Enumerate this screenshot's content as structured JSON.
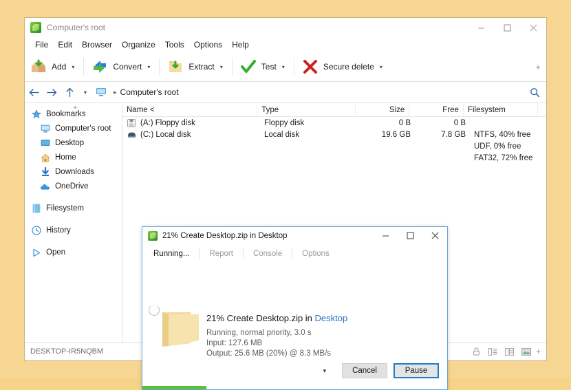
{
  "window": {
    "title": "Computer's root",
    "icon": "peazip-logo-icon",
    "controls": {
      "minimize": "minimize-icon",
      "maximize": "maximize-icon",
      "close": "close-icon"
    }
  },
  "menubar": {
    "items": [
      "File",
      "Edit",
      "Browser",
      "Organize",
      "Tools",
      "Options",
      "Help"
    ]
  },
  "toolbar": {
    "items": [
      {
        "label": "Add",
        "icon": "add-box-icon",
        "caret": "▾"
      },
      {
        "label": "Convert",
        "icon": "convert-arrows-icon",
        "caret": "▾"
      },
      {
        "label": "Extract",
        "icon": "extract-folder-icon",
        "caret": "▾"
      },
      {
        "label": "Test",
        "icon": "test-checkmark-icon",
        "caret": "▾"
      },
      {
        "label": "Secure delete",
        "icon": "secure-delete-x-icon",
        "caret": "▾"
      }
    ],
    "overflow": "+"
  },
  "addressbar": {
    "back": "back-arrow-icon",
    "forward": "forward-arrow-icon",
    "up": "up-arrow-icon",
    "history_caret": "▾",
    "computer_icon": "computer-icon",
    "separator": "▸",
    "path": "Computer's root",
    "search": "search-magnifier-icon"
  },
  "sidebar": {
    "add_bookmark": "+",
    "groups": [
      {
        "label": "Bookmarks",
        "icon": "star-icon",
        "indent": false,
        "gap": false
      },
      {
        "label": "Computer's root",
        "icon": "computer-icon",
        "indent": true,
        "gap": false
      },
      {
        "label": "Desktop",
        "icon": "desktop-icon",
        "indent": true,
        "gap": false
      },
      {
        "label": "Home",
        "icon": "home-icon",
        "indent": true,
        "gap": false
      },
      {
        "label": "Downloads",
        "icon": "download-icon",
        "indent": true,
        "gap": false
      },
      {
        "label": "OneDrive",
        "icon": "cloud-icon",
        "indent": true,
        "gap": false
      },
      {
        "label": "Filesystem",
        "icon": "filesystem-icon",
        "indent": false,
        "gap": true
      },
      {
        "label": "History",
        "icon": "clock-icon",
        "indent": false,
        "gap": true
      },
      {
        "label": "Open",
        "icon": "play-triangle-icon",
        "indent": false,
        "gap": true
      }
    ]
  },
  "filelist": {
    "columns": [
      "Name <",
      "Type",
      "Size",
      "Free",
      "Filesystem",
      ""
    ],
    "rows": [
      {
        "icon": "floppy-disk-icon",
        "name": "(A:) Floppy disk",
        "type": "Floppy disk",
        "size": "0 B",
        "free": "0 B",
        "fs": ""
      },
      {
        "icon": "hard-disk-icon",
        "name": "(C:) Local disk",
        "type": "Local disk",
        "size": "19.6 GB",
        "free": "7.8 GB",
        "fs": "NTFS, 40% free"
      },
      {
        "icon": "cd-drive-icon",
        "name": "",
        "type": "",
        "size": "",
        "free": "",
        "fs": "UDF, 0% free"
      },
      {
        "icon": "usb-drive-icon",
        "name": "",
        "type": "",
        "size": "",
        "free": "",
        "fs": "FAT32, 72% free"
      }
    ]
  },
  "statusbar": {
    "computer_name": "DESKTOP-IR5NQBM",
    "icons": [
      "lock-icon",
      "list-view-icon",
      "details-view-icon",
      "thumbnail-view-icon"
    ],
    "plus": "+"
  },
  "dialog": {
    "icon": "peazip-logo-icon",
    "title": "21% Create Desktop.zip in Desktop",
    "controls": {
      "minimize": "minimize-icon",
      "maximize": "maximize-icon",
      "close": "close-icon"
    },
    "tabs": [
      {
        "label": "Running...",
        "active": true
      },
      {
        "label": "Report",
        "active": false
      },
      {
        "label": "Console",
        "active": false
      },
      {
        "label": "Options",
        "active": false
      }
    ],
    "spinner": "loading-spinner-icon",
    "folder_icon": "folder-icon",
    "heading_prefix": "21% Create Desktop.zip in ",
    "heading_location": "Desktop",
    "status_line": "Running, normal priority, 3.0 s",
    "input_line": "Input: 127.6 MB",
    "output_line": "Output: 25.6 MB (20%) @ 8.3 MB/s",
    "more_caret": "▾",
    "cancel_label": "Cancel",
    "pause_label": "Pause",
    "progress_percent": 21,
    "progress_color": "#5fc031"
  }
}
